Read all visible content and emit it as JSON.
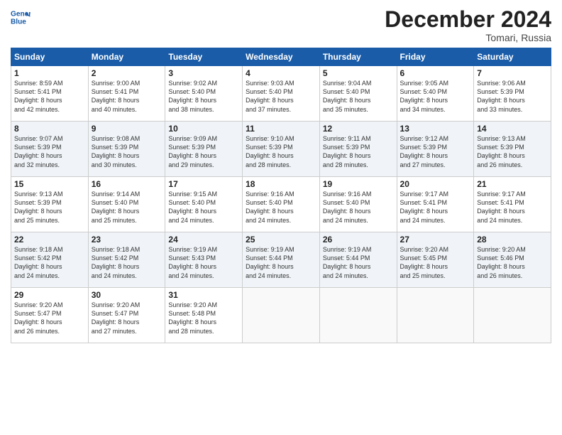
{
  "header": {
    "logo_line1": "General",
    "logo_line2": "Blue",
    "month_year": "December 2024",
    "location": "Tomari, Russia"
  },
  "days_of_week": [
    "Sunday",
    "Monday",
    "Tuesday",
    "Wednesday",
    "Thursday",
    "Friday",
    "Saturday"
  ],
  "weeks": [
    [
      {
        "day": "1",
        "text": "Sunrise: 8:59 AM\nSunset: 5:41 PM\nDaylight: 8 hours\nand 42 minutes."
      },
      {
        "day": "2",
        "text": "Sunrise: 9:00 AM\nSunset: 5:41 PM\nDaylight: 8 hours\nand 40 minutes."
      },
      {
        "day": "3",
        "text": "Sunrise: 9:02 AM\nSunset: 5:40 PM\nDaylight: 8 hours\nand 38 minutes."
      },
      {
        "day": "4",
        "text": "Sunrise: 9:03 AM\nSunset: 5:40 PM\nDaylight: 8 hours\nand 37 minutes."
      },
      {
        "day": "5",
        "text": "Sunrise: 9:04 AM\nSunset: 5:40 PM\nDaylight: 8 hours\nand 35 minutes."
      },
      {
        "day": "6",
        "text": "Sunrise: 9:05 AM\nSunset: 5:40 PM\nDaylight: 8 hours\nand 34 minutes."
      },
      {
        "day": "7",
        "text": "Sunrise: 9:06 AM\nSunset: 5:39 PM\nDaylight: 8 hours\nand 33 minutes."
      }
    ],
    [
      {
        "day": "8",
        "text": "Sunrise: 9:07 AM\nSunset: 5:39 PM\nDaylight: 8 hours\nand 32 minutes."
      },
      {
        "day": "9",
        "text": "Sunrise: 9:08 AM\nSunset: 5:39 PM\nDaylight: 8 hours\nand 30 minutes."
      },
      {
        "day": "10",
        "text": "Sunrise: 9:09 AM\nSunset: 5:39 PM\nDaylight: 8 hours\nand 29 minutes."
      },
      {
        "day": "11",
        "text": "Sunrise: 9:10 AM\nSunset: 5:39 PM\nDaylight: 8 hours\nand 28 minutes."
      },
      {
        "day": "12",
        "text": "Sunrise: 9:11 AM\nSunset: 5:39 PM\nDaylight: 8 hours\nand 28 minutes."
      },
      {
        "day": "13",
        "text": "Sunrise: 9:12 AM\nSunset: 5:39 PM\nDaylight: 8 hours\nand 27 minutes."
      },
      {
        "day": "14",
        "text": "Sunrise: 9:13 AM\nSunset: 5:39 PM\nDaylight: 8 hours\nand 26 minutes."
      }
    ],
    [
      {
        "day": "15",
        "text": "Sunrise: 9:13 AM\nSunset: 5:39 PM\nDaylight: 8 hours\nand 25 minutes."
      },
      {
        "day": "16",
        "text": "Sunrise: 9:14 AM\nSunset: 5:40 PM\nDaylight: 8 hours\nand 25 minutes."
      },
      {
        "day": "17",
        "text": "Sunrise: 9:15 AM\nSunset: 5:40 PM\nDaylight: 8 hours\nand 24 minutes."
      },
      {
        "day": "18",
        "text": "Sunrise: 9:16 AM\nSunset: 5:40 PM\nDaylight: 8 hours\nand 24 minutes."
      },
      {
        "day": "19",
        "text": "Sunrise: 9:16 AM\nSunset: 5:40 PM\nDaylight: 8 hours\nand 24 minutes."
      },
      {
        "day": "20",
        "text": "Sunrise: 9:17 AM\nSunset: 5:41 PM\nDaylight: 8 hours\nand 24 minutes."
      },
      {
        "day": "21",
        "text": "Sunrise: 9:17 AM\nSunset: 5:41 PM\nDaylight: 8 hours\nand 24 minutes."
      }
    ],
    [
      {
        "day": "22",
        "text": "Sunrise: 9:18 AM\nSunset: 5:42 PM\nDaylight: 8 hours\nand 24 minutes."
      },
      {
        "day": "23",
        "text": "Sunrise: 9:18 AM\nSunset: 5:42 PM\nDaylight: 8 hours\nand 24 minutes."
      },
      {
        "day": "24",
        "text": "Sunrise: 9:19 AM\nSunset: 5:43 PM\nDaylight: 8 hours\nand 24 minutes."
      },
      {
        "day": "25",
        "text": "Sunrise: 9:19 AM\nSunset: 5:44 PM\nDaylight: 8 hours\nand 24 minutes."
      },
      {
        "day": "26",
        "text": "Sunrise: 9:19 AM\nSunset: 5:44 PM\nDaylight: 8 hours\nand 24 minutes."
      },
      {
        "day": "27",
        "text": "Sunrise: 9:20 AM\nSunset: 5:45 PM\nDaylight: 8 hours\nand 25 minutes."
      },
      {
        "day": "28",
        "text": "Sunrise: 9:20 AM\nSunset: 5:46 PM\nDaylight: 8 hours\nand 26 minutes."
      }
    ],
    [
      {
        "day": "29",
        "text": "Sunrise: 9:20 AM\nSunset: 5:47 PM\nDaylight: 8 hours\nand 26 minutes."
      },
      {
        "day": "30",
        "text": "Sunrise: 9:20 AM\nSunset: 5:47 PM\nDaylight: 8 hours\nand 27 minutes."
      },
      {
        "day": "31",
        "text": "Sunrise: 9:20 AM\nSunset: 5:48 PM\nDaylight: 8 hours\nand 28 minutes."
      },
      {
        "day": "",
        "text": ""
      },
      {
        "day": "",
        "text": ""
      },
      {
        "day": "",
        "text": ""
      },
      {
        "day": "",
        "text": ""
      }
    ]
  ]
}
